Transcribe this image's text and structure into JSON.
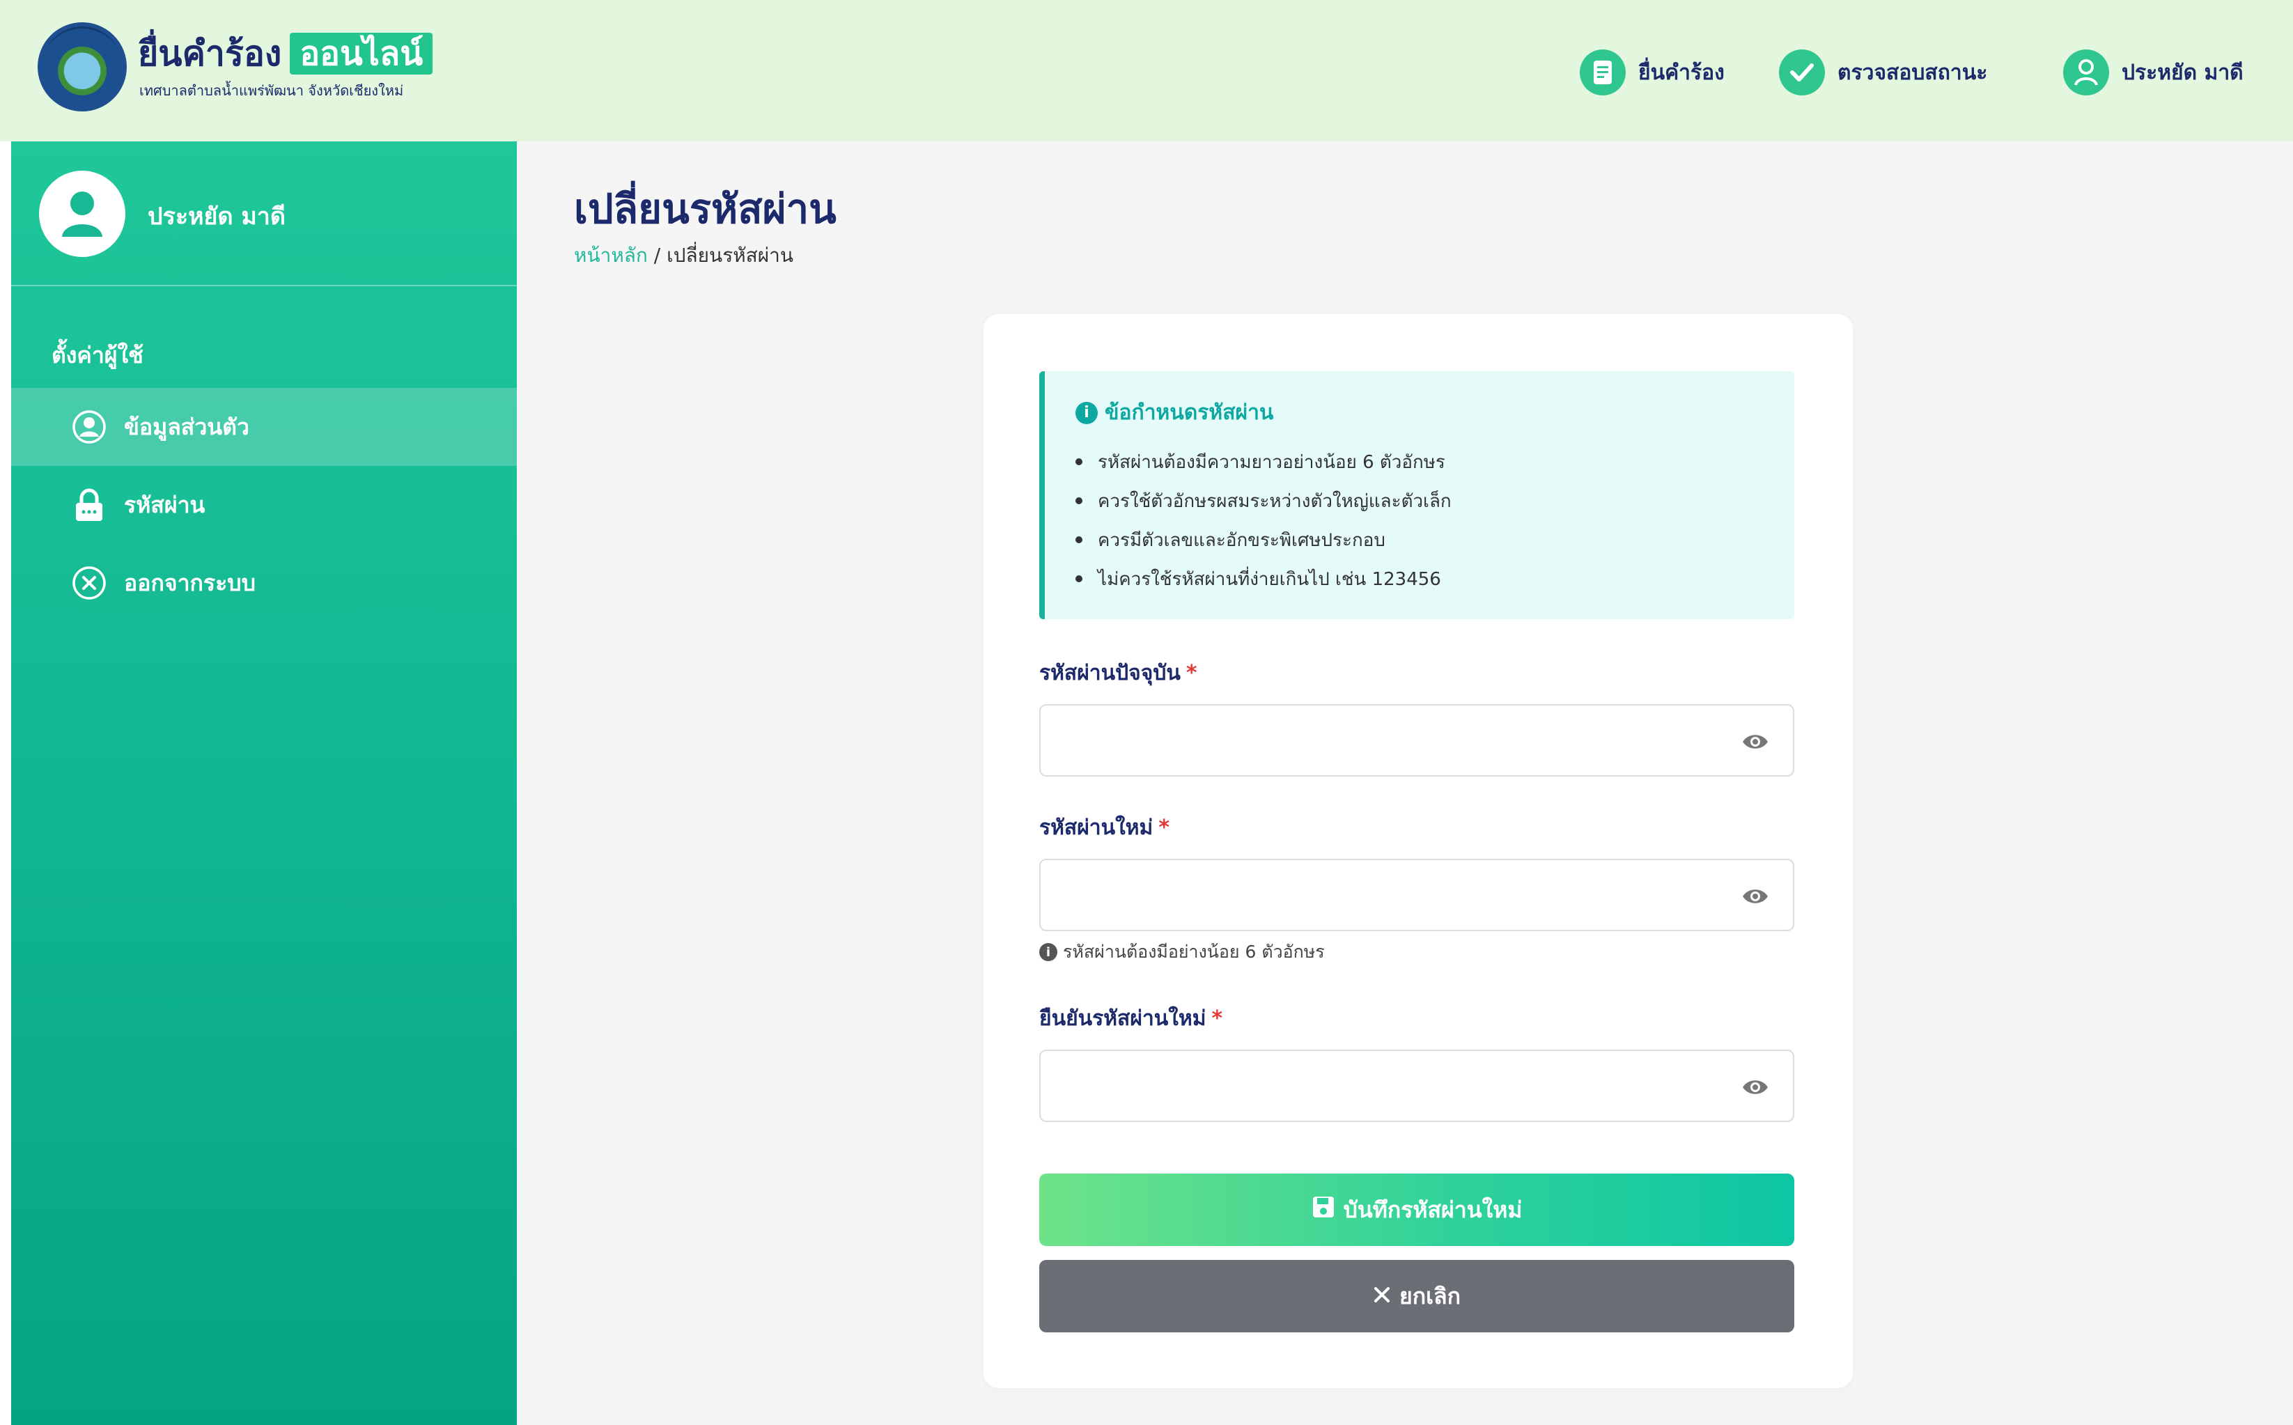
{
  "header": {
    "logo_title": "ยื่นคำร้อง",
    "logo_badge": "ออนไลน์",
    "logo_subtitle": "เทศบาลตำบลน้ำแพร่พัฒนา จังหวัดเชียงใหม่",
    "nav": [
      {
        "label": "ยื่นคำร้อง",
        "icon": "document-icon"
      },
      {
        "label": "ตรวจสอบสถานะ",
        "icon": "check-icon"
      },
      {
        "label": "ประหยัด มาดี",
        "icon": "user-icon"
      }
    ]
  },
  "sidebar": {
    "user_name": "ประหยัด มาดี",
    "section_title": "ตั้งค่าผู้ใช้",
    "items": [
      {
        "label": "ข้อมูลส่วนตัว",
        "icon": "user-circle-icon",
        "active": true
      },
      {
        "label": "รหัสผ่าน",
        "icon": "lock-icon",
        "active": false
      },
      {
        "label": "ออกจากระบบ",
        "icon": "close-circle-icon",
        "active": false
      }
    ]
  },
  "page": {
    "title": "เปลี่ยนรหัสผ่าน",
    "breadcrumb_home": "หน้าหลัก",
    "breadcrumb_sep": "/",
    "breadcrumb_current": "เปลี่ยนรหัสผ่าน"
  },
  "requirements": {
    "title": "ข้อกำหนดรหัสผ่าน",
    "items": [
      "รหัสผ่านต้องมีความยาวอย่างน้อย 6 ตัวอักษร",
      "ควรใช้ตัวอักษรผสมระหว่างตัวใหญ่และตัวเล็ก",
      "ควรมีตัวเลขและอักขระพิเศษประกอบ",
      "ไม่ควรใช้รหัสผ่านที่ง่ายเกินไป เช่น 123456"
    ]
  },
  "form": {
    "current_label": "รหัสผ่านปัจจุบัน",
    "new_label": "รหัสผ่านใหม่",
    "confirm_label": "ยืนยันรหัสผ่านใหม่",
    "required_mark": "*",
    "new_hint": "รหัสผ่านต้องมีอย่างน้อย 6 ตัวอักษร",
    "current_value": "",
    "new_value": "",
    "confirm_value": "",
    "save_label": "บันทึกรหัสผ่านใหม่",
    "cancel_label": "ยกเลิก"
  },
  "colors": {
    "header_bg": "#e2f7dd",
    "sidebar_top": "#20c79a",
    "sidebar_bottom": "#04a383",
    "title_navy": "#1c2a6b",
    "accent_teal": "#0fa7a1",
    "required_red": "#e53935",
    "cancel_gray": "#6b6f75"
  }
}
